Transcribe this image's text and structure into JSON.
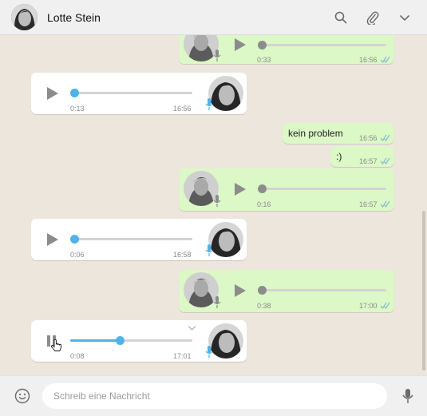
{
  "header": {
    "contact_name": "Lotte Stein"
  },
  "colors": {
    "accent_blue": "#4fb3e8",
    "out_bubble": "#dcf8c6",
    "in_bubble": "#ffffff",
    "read_ticks": "#8bb7d6"
  },
  "messages": [
    {
      "kind": "voice",
      "dir": "out",
      "duration": "0:33",
      "time": "16:56",
      "progress": 0
    },
    {
      "kind": "voice",
      "dir": "in",
      "duration": "0:13",
      "time": "16:56",
      "progress": 0
    },
    {
      "kind": "text",
      "dir": "out",
      "text": "kein problem",
      "time": "16:56"
    },
    {
      "kind": "text",
      "dir": "out",
      "text": ":)",
      "time": "16:57"
    },
    {
      "kind": "voice",
      "dir": "out",
      "duration": "0:16",
      "time": "16:57",
      "progress": 0
    },
    {
      "kind": "voice",
      "dir": "in",
      "duration": "0:06",
      "time": "16:58",
      "progress": 0
    },
    {
      "kind": "voice",
      "dir": "out",
      "duration": "0:38",
      "time": "17:00",
      "progress": 0
    },
    {
      "kind": "voice",
      "dir": "in",
      "duration": "0:08",
      "time": "17:01",
      "progress": 0.4,
      "playing": true
    }
  ],
  "composer": {
    "placeholder": "Schreib eine Nachricht"
  }
}
